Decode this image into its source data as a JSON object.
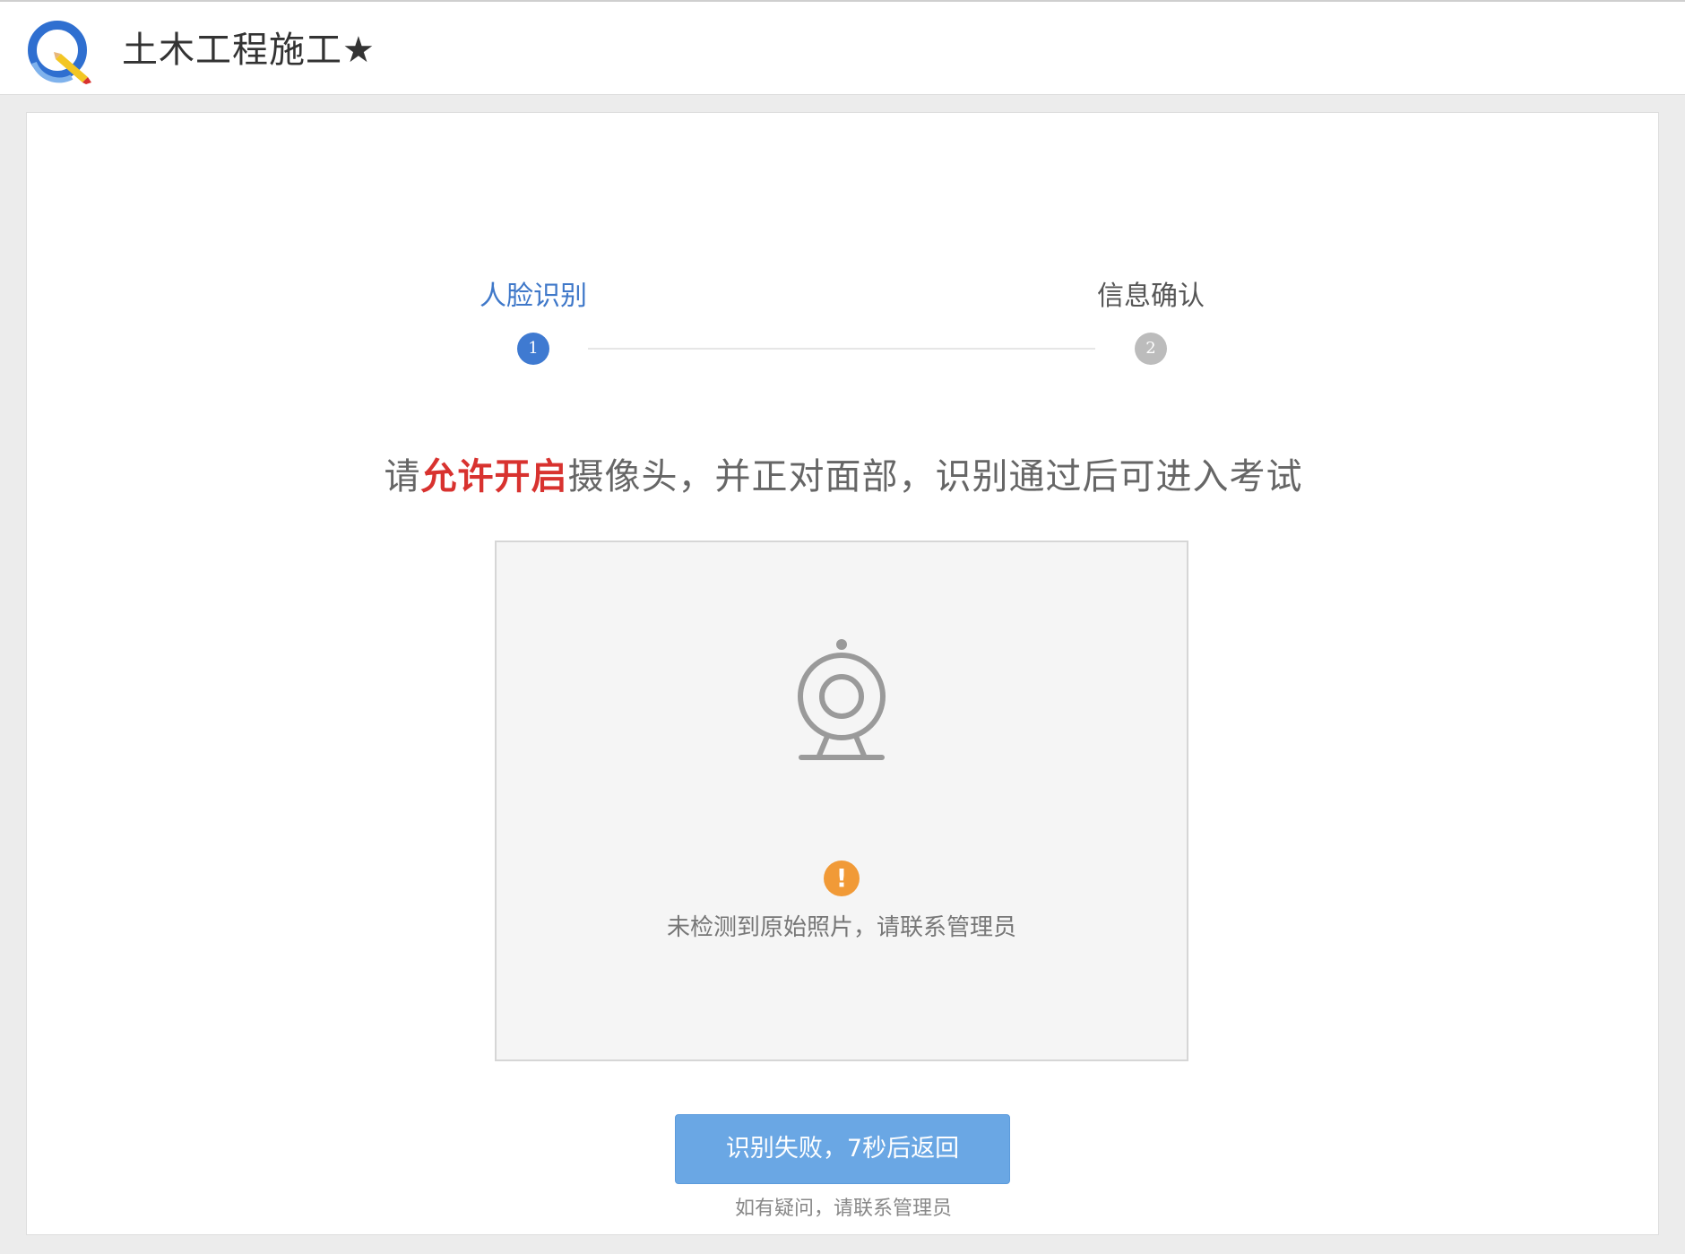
{
  "header": {
    "app_title": "土木工程施工★",
    "logo_icon": "search-pencil-logo-icon"
  },
  "steps": [
    {
      "label": "人脸识别",
      "number": "1",
      "state": "active"
    },
    {
      "label": "信息确认",
      "number": "2",
      "state": "inactive"
    }
  ],
  "instruction": {
    "prefix": "请",
    "highlight": "允许开启",
    "suffix": "摄像头，并正对面部，识别通过后可进入考试"
  },
  "camera_panel": {
    "icon": "webcam-icon",
    "warning_icon_glyph": "!",
    "error_message": "未检测到原始照片，请联系管理员"
  },
  "fail_button": {
    "label": "识别失败，7秒后返回"
  },
  "help_text": "如有疑问，请联系管理员",
  "colors": {
    "accent_blue": "#3f7ad1",
    "button_blue": "#6aa7e4",
    "highlight_red": "#d8322f",
    "warning_orange": "#f19a37"
  }
}
